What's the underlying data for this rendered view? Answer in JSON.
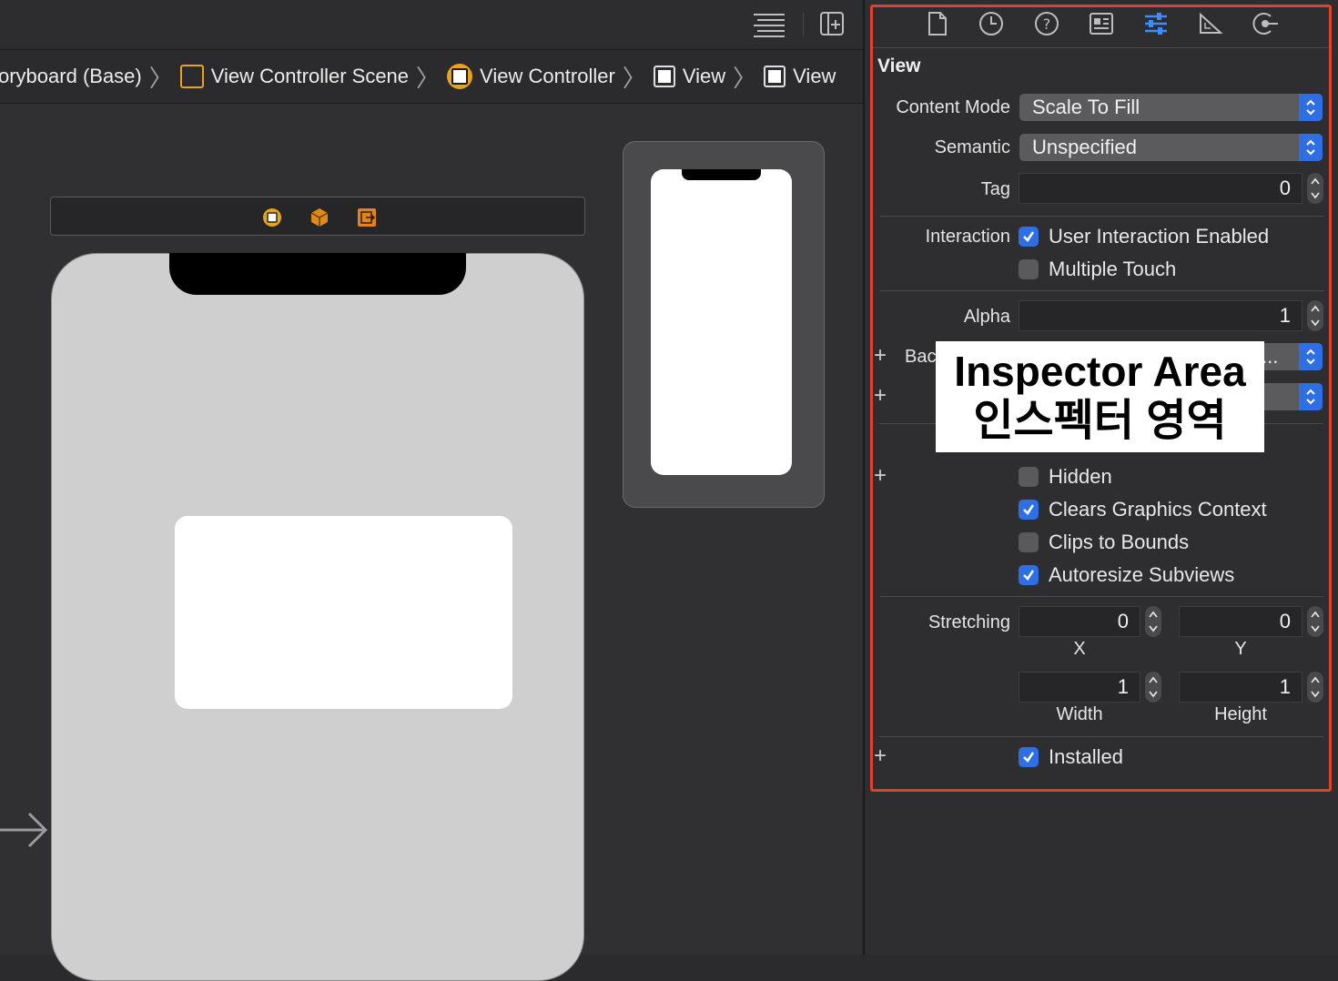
{
  "breadcrumb": {
    "items": [
      "oryboard (Base)",
      "View Controller Scene",
      "View Controller",
      "View",
      "View"
    ]
  },
  "inspector": {
    "section_title": "View",
    "content_mode": {
      "label": "Content Mode",
      "value": "Scale To Fill"
    },
    "semantic": {
      "label": "Semantic",
      "value": "Unspecified"
    },
    "tag": {
      "label": "Tag",
      "value": "0"
    },
    "interaction": {
      "label": "Interaction",
      "user_interaction": {
        "label": "User Interaction Enabled",
        "checked": true
      },
      "multiple_touch": {
        "label": "Multiple Touch",
        "checked": false
      }
    },
    "alpha": {
      "label": "Alpha",
      "value": "1"
    },
    "background": {
      "label": "Bac",
      "value": "..."
    },
    "drawing": {
      "hidden": {
        "label": "Hidden",
        "checked": false
      },
      "clears_graphics": {
        "label": "Clears Graphics Context",
        "checked": true
      },
      "clips_to_bounds": {
        "label": "Clips to Bounds",
        "checked": false
      },
      "autoresize": {
        "label": "Autoresize Subviews",
        "checked": true
      }
    },
    "stretching": {
      "label": "Stretching",
      "x": {
        "value": "0",
        "caption": "X"
      },
      "y": {
        "value": "0",
        "caption": "Y"
      },
      "width": {
        "value": "1",
        "caption": "Width"
      },
      "height": {
        "value": "1",
        "caption": "Height"
      }
    },
    "installed": {
      "label": "Installed",
      "checked": true
    }
  },
  "callout": {
    "line1": "Inspector Area",
    "line2": "인스펙터 영역"
  },
  "colors": {
    "accent": "#2f6fe4",
    "highlight_border": "#e2412e",
    "view_controller_icon": "#e8a31b"
  }
}
